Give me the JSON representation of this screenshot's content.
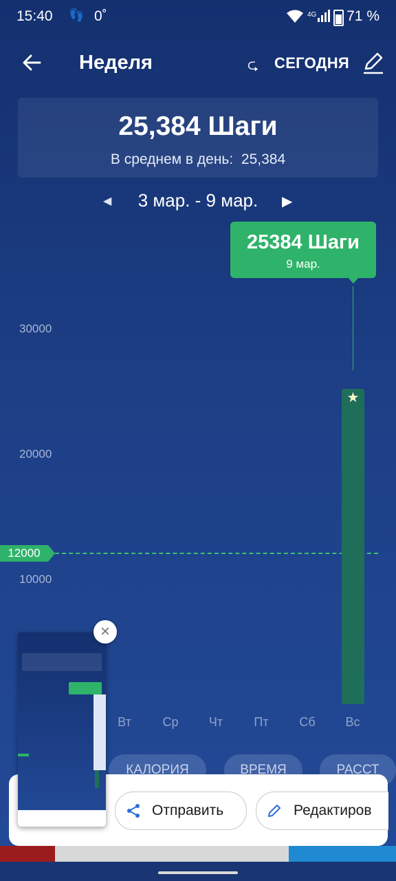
{
  "status_bar": {
    "time": "15:40",
    "temperature": "0˚",
    "network": "4G",
    "battery": "71 %"
  },
  "toolbar": {
    "title": "Неделя",
    "today_label": "СЕГОДНЯ"
  },
  "summary": {
    "total_steps": "25,384 Шаги",
    "avg_label": "В среднем в день:",
    "avg_value": "25,384"
  },
  "date_nav": {
    "range": "3 мар. - 9 мар."
  },
  "tooltip": {
    "steps": "25384 Шаги",
    "date": "9 мар."
  },
  "chart_data": {
    "type": "bar",
    "categories": [
      "Вт",
      "Ср",
      "Чт",
      "Пт",
      "Сб",
      "Вс"
    ],
    "values": [
      0,
      0,
      0,
      0,
      0,
      25384
    ],
    "y_ticks": [
      "30000",
      "20000",
      "10000"
    ],
    "goal_value": "12000",
    "ylim": [
      0,
      35000
    ],
    "highlight_color": "#2fb36a",
    "bar_color": "#1f6e5a"
  },
  "metric_tabs": [
    "КАЛОРИЯ",
    "ВРЕМЯ",
    "РАССТ"
  ],
  "share_sheet": {
    "send_label": "Отправить",
    "edit_label": "Редактиров"
  },
  "colors": {
    "accent": "#2fb36a",
    "background_top": "#14306f",
    "background_bottom": "#234a98"
  }
}
